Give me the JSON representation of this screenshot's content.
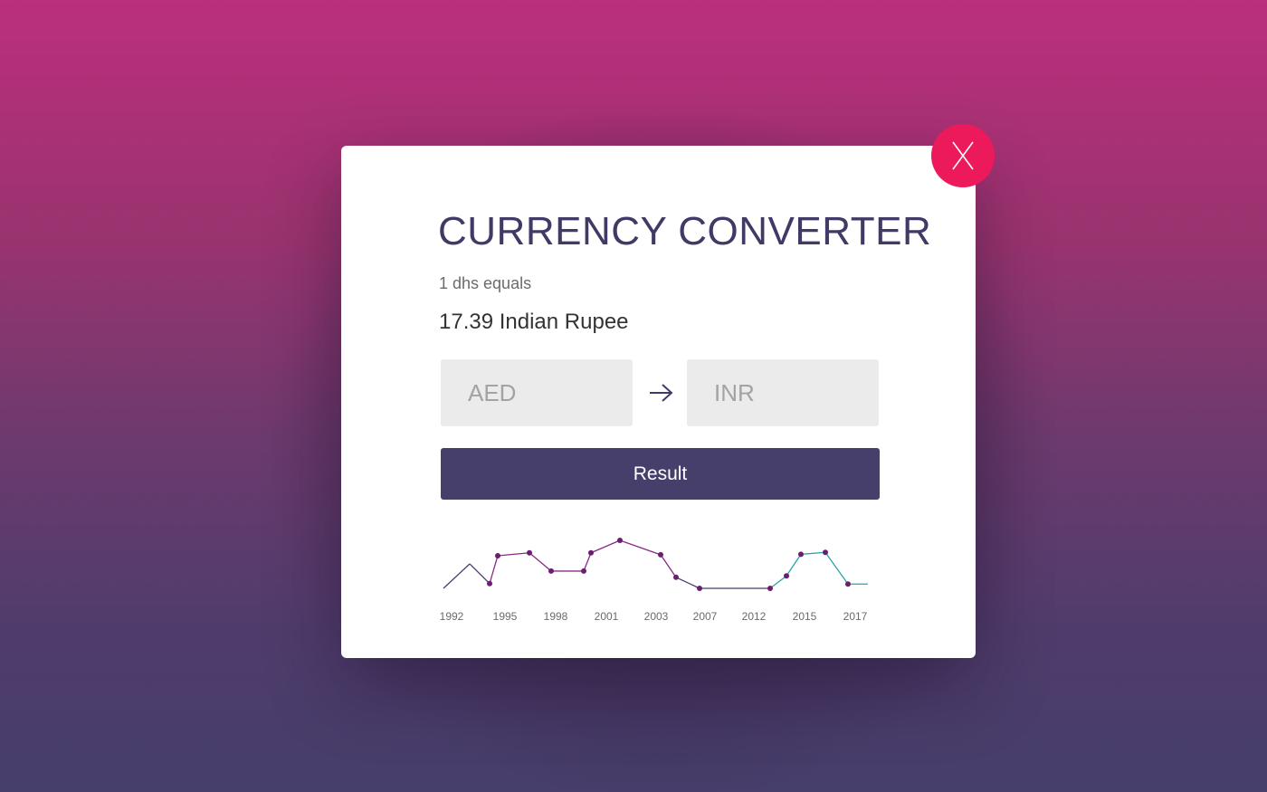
{
  "dialog": {
    "title": "CURRENCY CONVERTER",
    "subtitle": "1 dhs equals",
    "result_text": "17.39 Indian Rupee",
    "from_currency": "AED",
    "to_currency": "INR",
    "result_button_label": "Result",
    "close_label": "X"
  },
  "icons": {
    "close": "close-icon",
    "swap_arrow": "arrow-right-icon"
  },
  "colors": {
    "title": "#3f3a66",
    "button": "#463f6b",
    "close_button": "#ec1a5a",
    "line_primary": "#8a2a85",
    "line_secondary": "#2aa3a8",
    "point": "#6a1f6e"
  },
  "chart_data": {
    "type": "line",
    "title": "",
    "xlabel": "",
    "ylabel": "",
    "tick_labels": [
      "1992",
      "1995",
      "1998",
      "2001",
      "2003",
      "2007",
      "2012",
      "2015",
      "2017"
    ],
    "y_axis_shown": false,
    "grid": false,
    "points": [
      {
        "v": 0.0,
        "marker": false,
        "seg": "navy"
      },
      {
        "v": 0.51,
        "marker": false,
        "seg": "navy"
      },
      {
        "v": 0.1,
        "marker": true,
        "seg": "navy"
      },
      {
        "v": 0.68,
        "marker": true,
        "seg": "purple"
      },
      {
        "v": 0.74,
        "marker": true,
        "seg": "purple"
      },
      {
        "v": 0.36,
        "marker": true,
        "seg": "purple"
      },
      {
        "v": 0.36,
        "marker": true,
        "seg": "purple"
      },
      {
        "v": 0.74,
        "marker": true,
        "seg": "purple"
      },
      {
        "v": 1.0,
        "marker": true,
        "seg": "purple"
      },
      {
        "v": 0.7,
        "marker": true,
        "seg": "purple"
      },
      {
        "v": 0.23,
        "marker": true,
        "seg": "purple"
      },
      {
        "v": 0.0,
        "marker": true,
        "seg": "navy"
      },
      {
        "v": 0.0,
        "marker": true,
        "seg": "navy"
      },
      {
        "v": 0.26,
        "marker": true,
        "seg": "teal"
      },
      {
        "v": 0.71,
        "marker": true,
        "seg": "teal"
      },
      {
        "v": 0.75,
        "marker": true,
        "seg": "teal"
      },
      {
        "v": 0.09,
        "marker": true,
        "seg": "teal"
      },
      {
        "v": 0.09,
        "marker": false,
        "seg": "teal"
      }
    ]
  }
}
